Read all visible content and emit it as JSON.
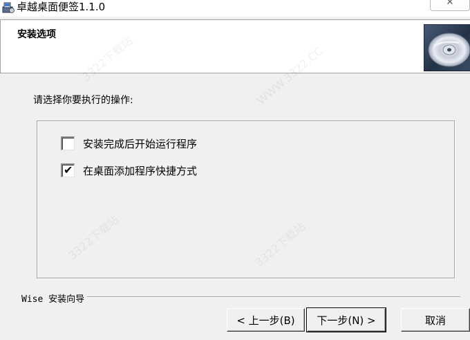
{
  "window": {
    "title": "卓越桌面便签1.1.0",
    "close_glyph": "✕"
  },
  "header": {
    "title": "安装选项",
    "image_icon": "cd-disc-icon"
  },
  "main": {
    "prompt": "请选择你要执行的操作:",
    "options": [
      {
        "label": "安装完成后开始运行程序",
        "checked": false
      },
      {
        "label": "在桌面添加程序快捷方式",
        "checked": true
      }
    ]
  },
  "footer": {
    "wizard_label": "Wise 安装向导",
    "back_label": "< 上一步(B)",
    "next_label": "下一步(N) >",
    "cancel_label": "取消"
  },
  "watermarks": [
    "3322下载站",
    "WWW.3322.CC"
  ],
  "icons": {
    "check_glyph": "✔"
  },
  "colors": {
    "dialog_bg": "#f0f0f0",
    "header_bg": "#ffffff",
    "cd_panel": "#2c3b53"
  }
}
